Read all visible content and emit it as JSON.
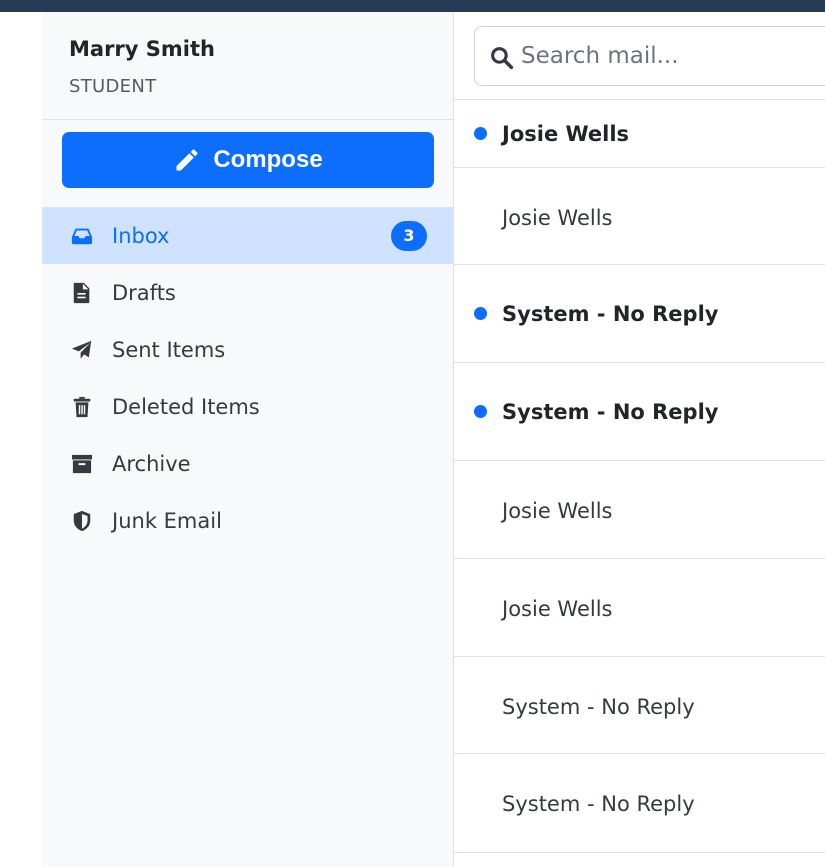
{
  "user": {
    "name": "Marry Smith",
    "role": "STUDENT"
  },
  "compose": {
    "label": "Compose"
  },
  "nav": [
    {
      "label": "Inbox",
      "icon": "inbox-icon",
      "badge": "3",
      "active": true
    },
    {
      "label": "Drafts",
      "icon": "file-icon",
      "active": false
    },
    {
      "label": "Sent Items",
      "icon": "paper-plane-icon",
      "active": false
    },
    {
      "label": "Deleted Items",
      "icon": "trash-icon",
      "active": false
    },
    {
      "label": "Archive",
      "icon": "archive-box-icon",
      "active": false
    },
    {
      "label": "Junk Email",
      "icon": "shield-icon",
      "active": false
    }
  ],
  "search": {
    "placeholder": "Search mail..."
  },
  "mails": [
    {
      "sender": "Josie Wells",
      "unread": true
    },
    {
      "sender": "Josie Wells",
      "unread": false
    },
    {
      "sender": "System - No Reply",
      "unread": true
    },
    {
      "sender": "System - No Reply",
      "unread": true
    },
    {
      "sender": "Josie Wells",
      "unread": false
    },
    {
      "sender": "Josie Wells",
      "unread": false
    },
    {
      "sender": "System - No Reply",
      "unread": false
    },
    {
      "sender": "System - No Reply",
      "unread": false
    }
  ],
  "colors": {
    "accent": "#0d6efd",
    "topbar": "#253b56",
    "sidebar_bg": "#f8f9fa",
    "active_bg": "#cfe2ff"
  }
}
